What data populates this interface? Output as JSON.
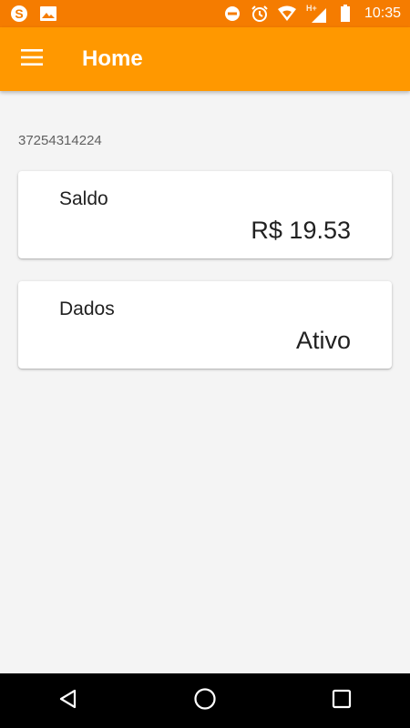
{
  "status_bar": {
    "time": "10:35",
    "network_type": "H+",
    "icons_left": [
      "skype-icon",
      "image-icon"
    ],
    "icons_right": [
      "do-not-disturb-icon",
      "alarm-icon",
      "wifi-icon",
      "signal-icon",
      "battery-icon"
    ]
  },
  "app_bar": {
    "title": "Home",
    "menu_icon": "hamburger-menu-icon",
    "color": "#ff9800",
    "status_color": "#f57c00"
  },
  "account": {
    "number": "37254314224"
  },
  "cards": {
    "saldo": {
      "label": "Saldo",
      "value": "R$ 19.53"
    },
    "dados": {
      "label": "Dados",
      "value": "Ativo"
    }
  },
  "nav_bar": {
    "buttons": [
      "back-icon",
      "home-icon",
      "recents-icon"
    ]
  }
}
